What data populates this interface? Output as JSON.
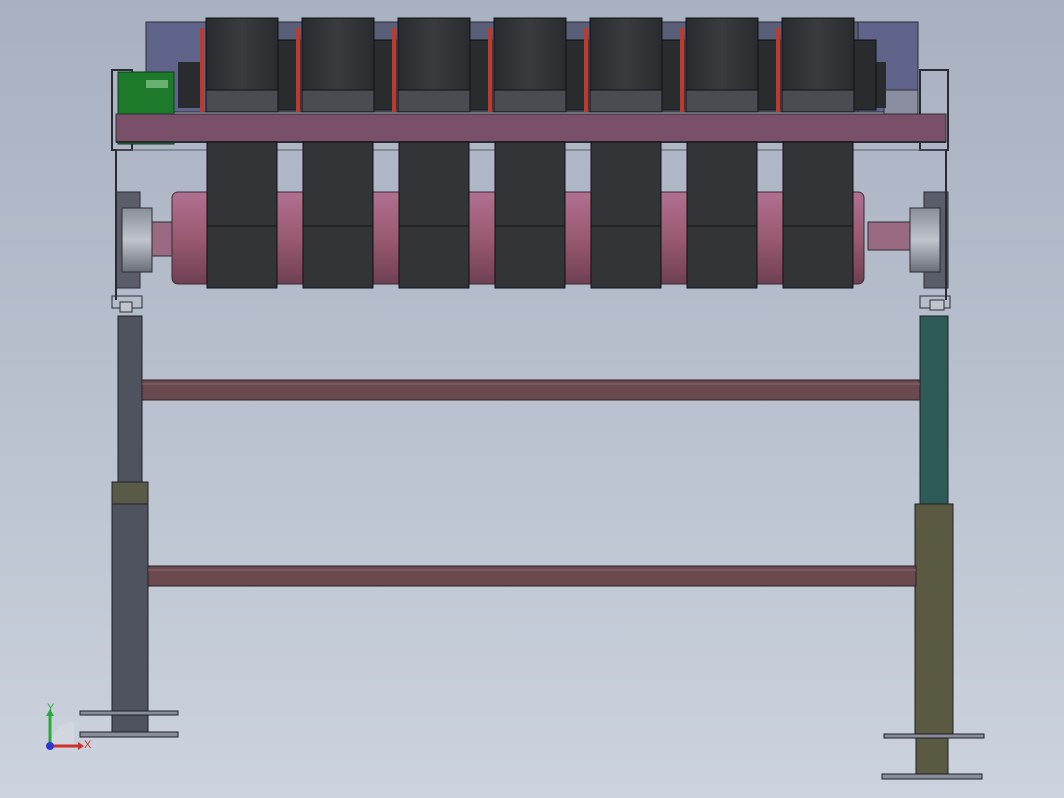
{
  "viewport": {
    "background_top": "#a9b1c1",
    "background_bottom": "#ccd3de"
  },
  "model": {
    "frame_color": "#4a4e5a",
    "crossbeam_color": "#6b4a4f",
    "top_beam_color": "#7a4f6a",
    "roller_color": "#9a5a72",
    "pulley_color": "#2f3033",
    "left_leg_color": "#4f5360",
    "right_leg_upper_color": "#2e5a58",
    "right_leg_lower_color": "#5a5a42",
    "motor_color": "#1d7a2a",
    "accent_red": "#c0392b",
    "pulley_count": 7
  },
  "triad": {
    "x_label": "X",
    "y_label": "Y",
    "x_color": "#d0302a",
    "y_color": "#2aa83a",
    "z_color": "#2a3ad0"
  }
}
